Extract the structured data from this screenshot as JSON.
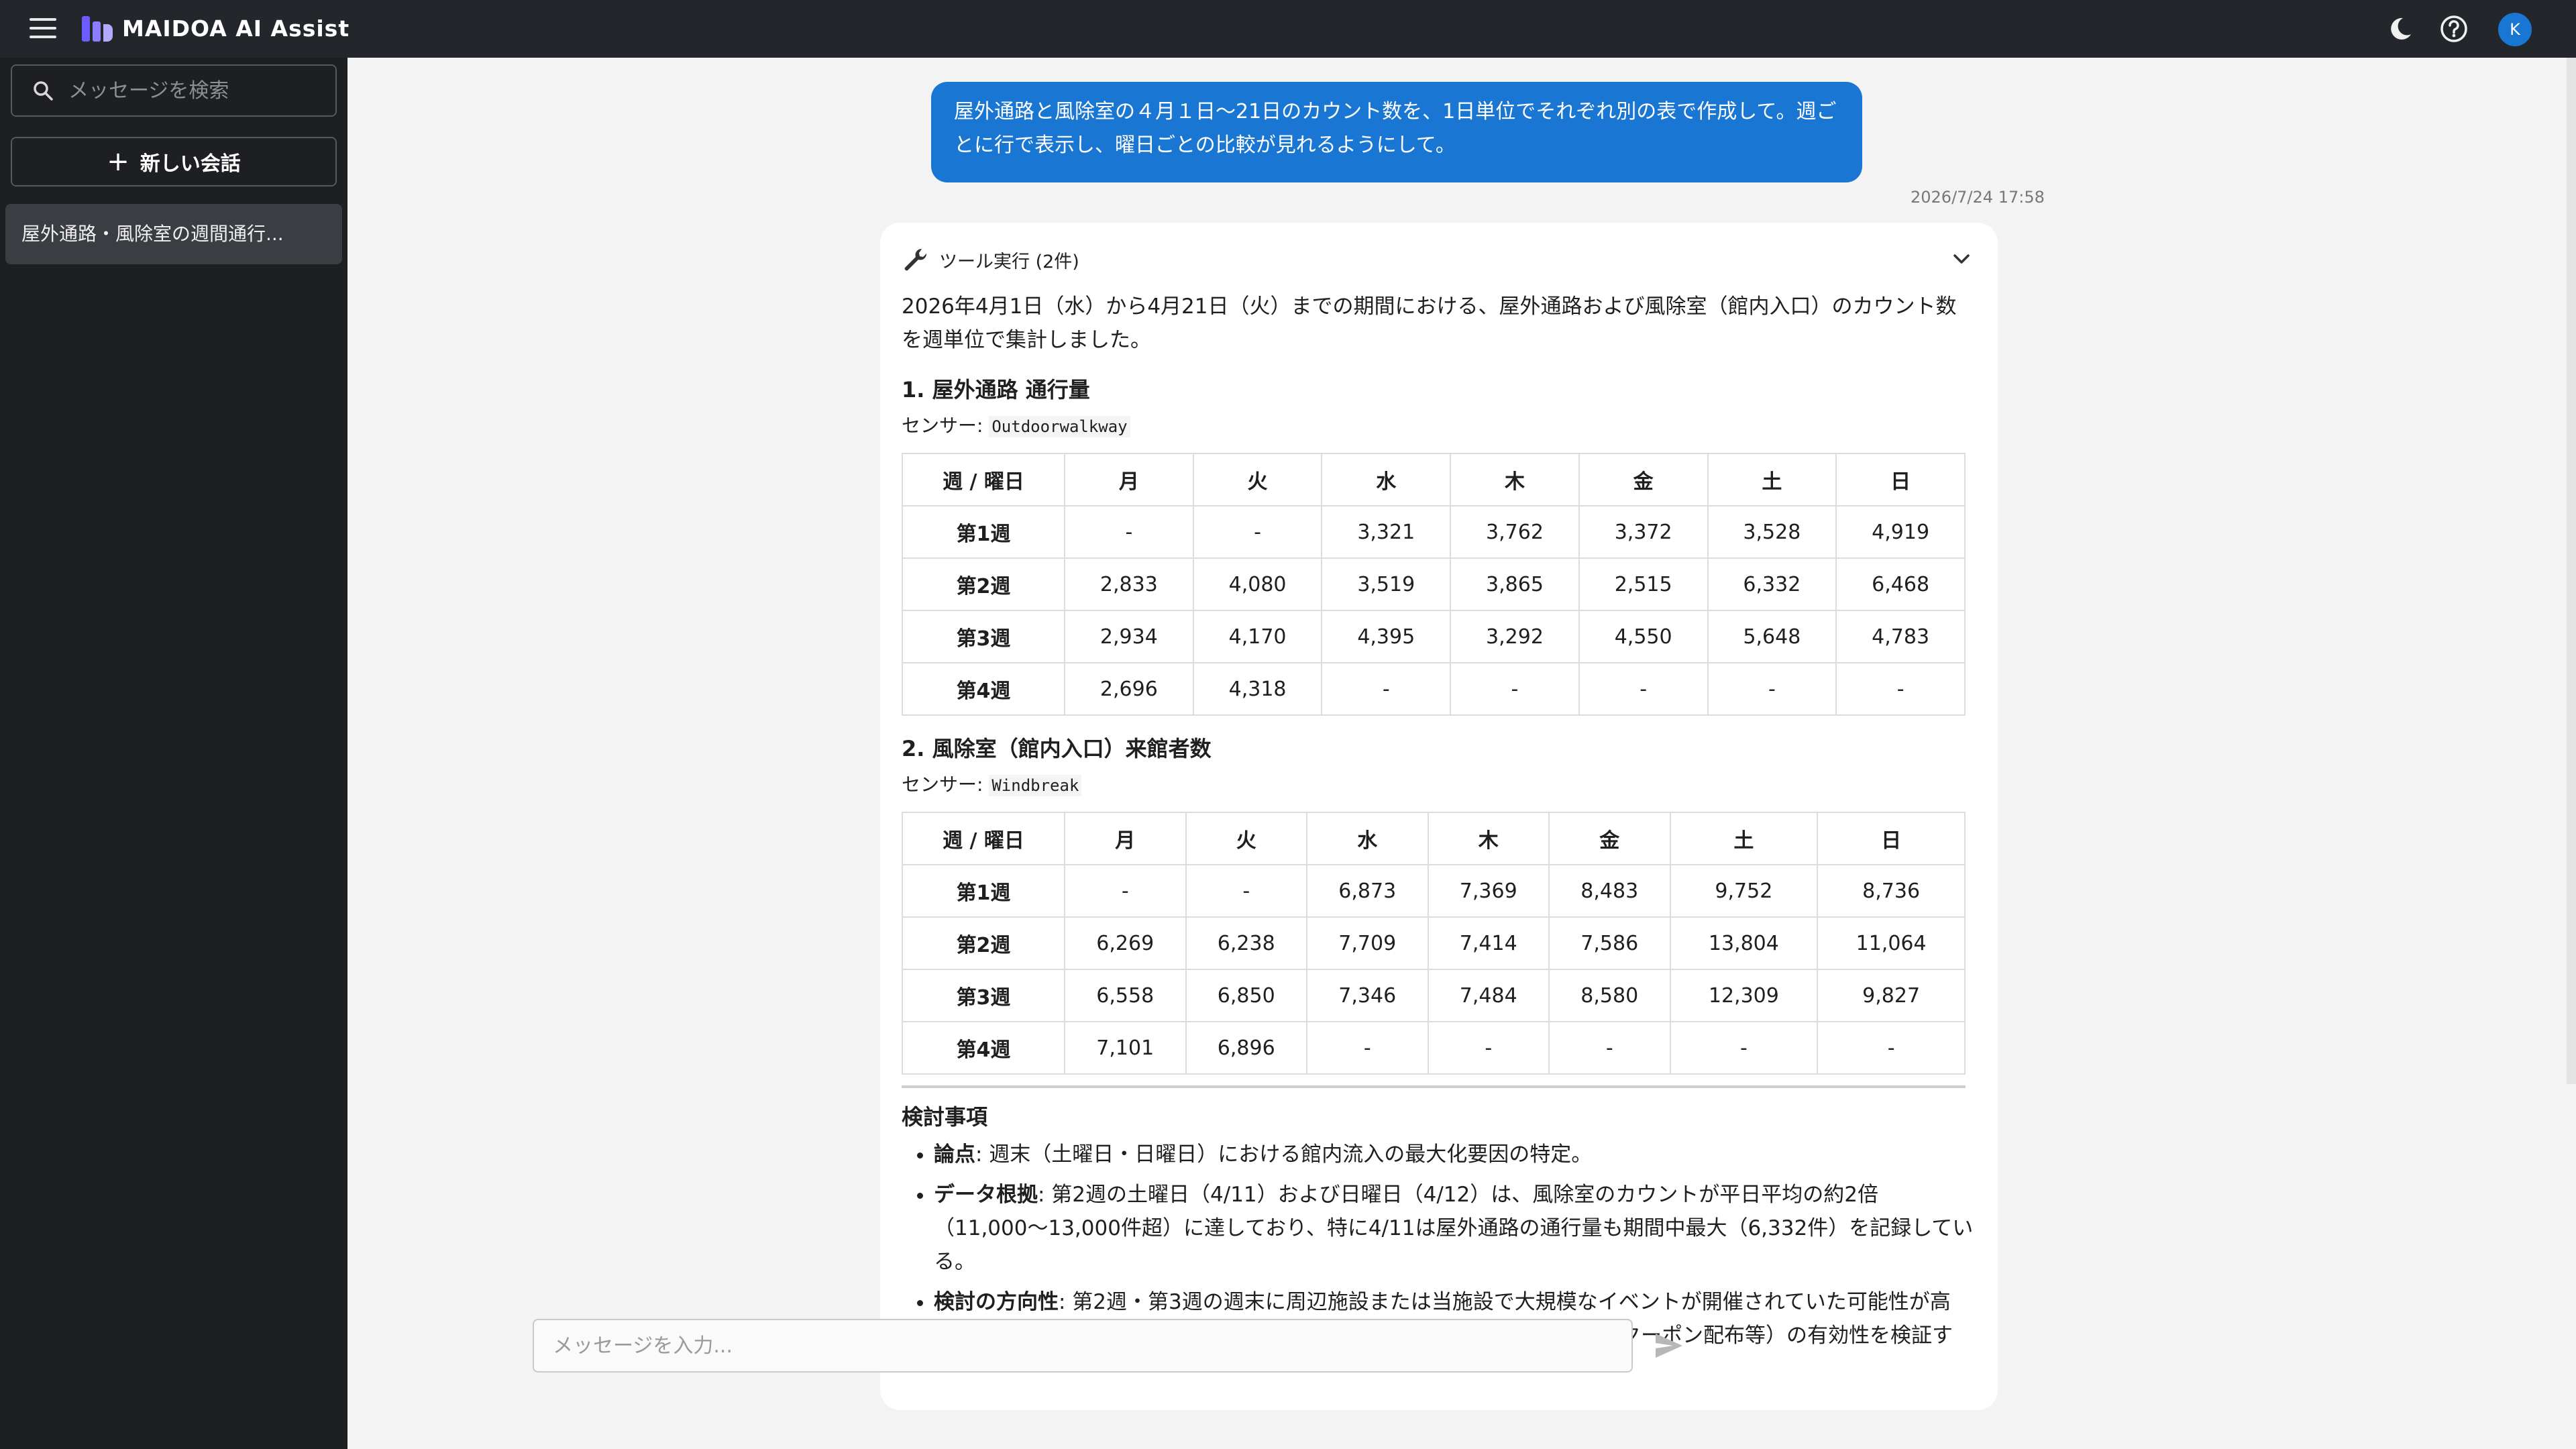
{
  "header": {
    "app_title": "MAIDOA AI Assist",
    "avatar_initial": "K",
    "icons": [
      "menu-icon",
      "logo",
      "moon-icon",
      "help-icon"
    ]
  },
  "sidebar": {
    "search_placeholder": "メッセージを検索",
    "new_chat_label": "新しい会話",
    "conversations": [
      {
        "title": "屋外通路・風除室の週間通行..."
      }
    ]
  },
  "chat": {
    "user_message": "屋外通路と風除室の４月１日〜21日のカウント数を、1日単位でそれぞれ別の表で作成して。週ごとに行で表示し、曜日ごとの比較が見れるようにして。",
    "timestamp": "2026/7/24 17:58",
    "tool_label": "ツール実行 (2件)",
    "intro": "2026年4月1日（水）から4月21日（火）までの期間における、屋外通路および風除室（館内入口）のカウント数を週単位で集計しました。",
    "section1": {
      "title": "1. 屋外通路 通行量",
      "sensor_label": "センサー: ",
      "sensor_id": "Outdoorwalkway",
      "headers": [
        "週 / 曜日",
        "月",
        "火",
        "水",
        "木",
        "金",
        "土",
        "日"
      ],
      "rows": [
        [
          "第1週",
          "-",
          "-",
          "3,321",
          "3,762",
          "3,372",
          "3,528",
          "4,919"
        ],
        [
          "第2週",
          "2,833",
          "4,080",
          "3,519",
          "3,865",
          "2,515",
          "6,332",
          "6,468"
        ],
        [
          "第3週",
          "2,934",
          "4,170",
          "4,395",
          "3,292",
          "4,550",
          "5,648",
          "4,783"
        ],
        [
          "第4週",
          "2,696",
          "4,318",
          "-",
          "-",
          "-",
          "-",
          "-"
        ]
      ]
    },
    "section2": {
      "title": "2. 風除室（館内入口）来館者数",
      "sensor_label": "センサー: ",
      "sensor_id": "Windbreak",
      "headers": [
        "週 / 曜日",
        "月",
        "火",
        "水",
        "木",
        "金",
        "土",
        "日"
      ],
      "rows": [
        [
          "第1週",
          "-",
          "-",
          "6,873",
          "7,369",
          "8,483",
          "9,752",
          "8,736"
        ],
        [
          "第2週",
          "6,269",
          "6,238",
          "7,709",
          "7,414",
          "7,586",
          "13,804",
          "11,064"
        ],
        [
          "第3週",
          "6,558",
          "6,850",
          "7,346",
          "7,484",
          "8,580",
          "12,309",
          "9,827"
        ],
        [
          "第4週",
          "7,101",
          "6,896",
          "-",
          "-",
          "-",
          "-",
          "-"
        ]
      ]
    },
    "notes": {
      "title": "検討事項",
      "items": [
        {
          "label": "論点",
          "text": ": 週末（土曜日・日曜日）における館内流入の最大化要因の特定。"
        },
        {
          "label": "データ根拠",
          "text": ": 第2週の土曜日（4/11）および日曜日（4/12）は、風除室のカウントが平日平均の約2倍（11,000〜13,000件超）に達しており、特に4/11は屋外通路の通行量も期間中最大（6,332件）を記録している。"
        },
        {
          "label": "検討の方向性",
          "text": ": 第2週・第3週の週末に周辺施設または当施設で大規模なイベントが開催されていた可能性が高い。これらのピーク日に合わせた館内テナントへの回遊促進施策（アプリクーポン配布等）の有効性を検証す"
        }
      ]
    }
  },
  "composer": {
    "placeholder": "メッセージを入力..."
  },
  "colors": {
    "header_bg": "#23262b",
    "sidebar_bg": "#1d1f22",
    "accent": "#1976d2"
  }
}
